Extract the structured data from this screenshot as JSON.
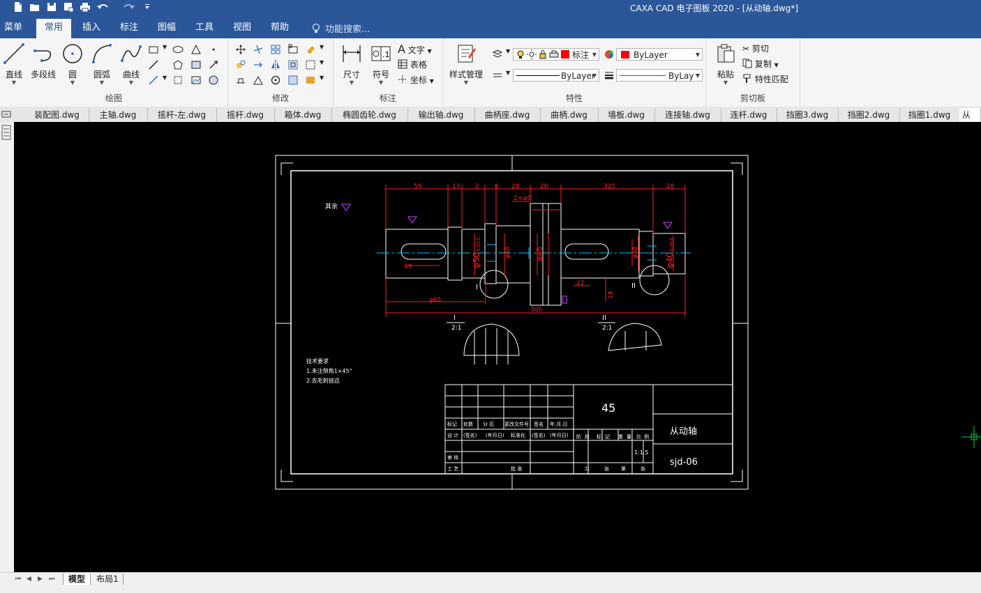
{
  "title": "CAXA CAD 电子图板 2020 - [从动轴.dwg*]",
  "menu": [
    {
      "label": "菜单",
      "active": false
    },
    {
      "label": "常用",
      "active": true
    },
    {
      "label": "插入",
      "active": false
    },
    {
      "label": "标注",
      "active": false
    },
    {
      "label": "图幅",
      "active": false
    },
    {
      "label": "工具",
      "active": false
    },
    {
      "label": "视图",
      "active": false
    },
    {
      "label": "帮助",
      "active": false
    }
  ],
  "search_placeholder": "功能搜索...",
  "ribbon": {
    "draw": {
      "label": "绘图",
      "line": "直线",
      "polyline": "多段线",
      "circle": "圆",
      "arc": "圆弧",
      "curve": "曲线"
    },
    "modify": {
      "label": "修改"
    },
    "annotate": {
      "label": "标注",
      "dimension": "尺寸",
      "symbol": "符号",
      "text": "文字",
      "table": "表格",
      "coordinate": "坐标"
    },
    "properties": {
      "label": "特性",
      "style_manager": "样式管理",
      "layer": "标注",
      "color": "ByLayer",
      "linetype": "ByLayer",
      "linewidth": "ByLay",
      "color_swatch": "#ff0000"
    },
    "clipboard": {
      "label": "剪切板",
      "paste": "粘贴",
      "cut": "剪切",
      "copy": "复制",
      "match": "特性匹配"
    }
  },
  "doc_tabs": [
    "装配图.dwg",
    "主轴.dwg",
    "摇杆-左.dwg",
    "摇杆.dwg",
    "箱体.dwg",
    "椭圆齿轮.dwg",
    "输出轴.dwg",
    "曲柄座.dwg",
    "曲柄.dwg",
    "墙板.dwg",
    "连接轴.dwg",
    "连杆.dwg",
    "挡圈3.dwg",
    "挡圈2.dwg",
    "挡圈1.dwg",
    "从"
  ],
  "layout_tabs": [
    {
      "label": "模型",
      "active": true
    },
    {
      "label": "布局1",
      "active": false
    }
  ],
  "drawing": {
    "dims_top": [
      "59",
      "13",
      "2",
      "6",
      "28",
      "26",
      "325",
      "28"
    ],
    "dim_keyway1": "2×φ8",
    "dim_keyway_len": "49",
    "dim_phi50": "φ50",
    "dim_phi50_tol": "0.025",
    "dim_phi48": "φ48",
    "dim_phi45": "φ45",
    "dim_phi40": "φ40",
    "dim_phi40_tol": "0.016",
    "dim_phi38": "φ38",
    "dim_22": "22",
    "dim_14": "14",
    "dim_phi65": "φ65",
    "dim_305": "305",
    "mark_I": "I",
    "mark_II": "II",
    "sec1_label": "I",
    "sec1_scale": "2:1",
    "sec2_label": "II",
    "sec2_scale": "2:1",
    "rough": "其余",
    "notes": [
      "技术要求",
      "1.未注倒角1×45°",
      "2.去毛刺锐边"
    ],
    "material": "45",
    "part_name": "从动轴",
    "drawing_no": "sjd-06",
    "scale": "1:1.5",
    "tb_row1": [
      "标记",
      "处数",
      "分 区",
      "更改文件号",
      "签名",
      "年.月.日"
    ],
    "tb_row2": [
      "设 计",
      "(签名)",
      "(年月日)",
      "标准化",
      "(签名)",
      "(年月日)"
    ],
    "tb_row3": [
      "审 核"
    ],
    "tb_row4": [
      "工 艺",
      "批 准"
    ],
    "tb_stage": [
      "阶",
      "段",
      "标",
      "记",
      "重",
      "量",
      "比",
      "例"
    ],
    "tb_sheet": [
      "共",
      "张",
      "第",
      "张"
    ]
  }
}
